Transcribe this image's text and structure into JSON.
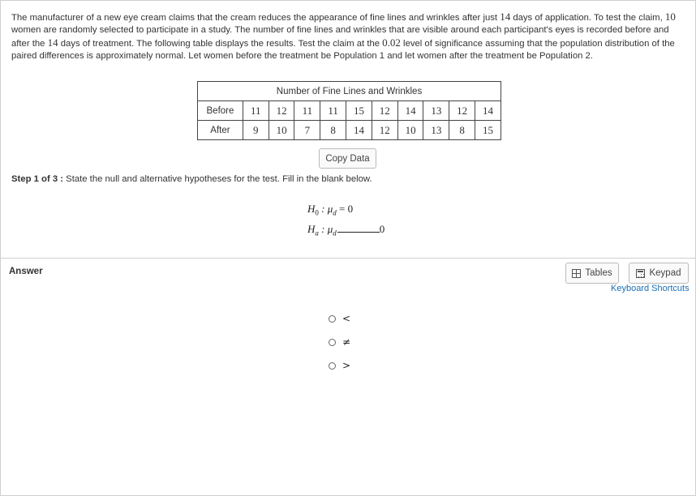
{
  "prompt": {
    "p1": "The manufacturer of a new eye cream claims that the cream reduces the appearance of fine lines and wrinkles after just ",
    "n1": "14",
    "p2": " days of application. To test the claim, ",
    "n2": "10",
    "p3": " women are randomly selected to participate in a study. The number of fine lines and wrinkles that are visible around each participant's eyes is recorded before and after the ",
    "n3": "14",
    "p4": " days of treatment. The following table displays the results. Test the claim at the ",
    "n4": "0.02",
    "p5": " level of significance assuming that the population distribution of the paired differences is approximately normal. Let women before the treatment be Population 1 and let women after the treatment be Population 2."
  },
  "table": {
    "caption": "Number of Fine Lines and Wrinkles",
    "before_label": "Before",
    "after_label": "After",
    "before": [
      "11",
      "12",
      "11",
      "11",
      "15",
      "12",
      "14",
      "13",
      "12",
      "14"
    ],
    "after": [
      "9",
      "10",
      "7",
      "8",
      "14",
      "12",
      "10",
      "13",
      "8",
      "15"
    ]
  },
  "copy_button": "Copy Data",
  "step": {
    "label": "Step 1 of 3 :",
    "text": " State the null and alternative hypotheses for the test. Fill in the blank below."
  },
  "hypotheses": {
    "h0_symbol": "H",
    "h0_sub": "0",
    "h0_body": " : μ",
    "h0_mu_sub": "d",
    "h0_rhs": " = 0",
    "ha_symbol": "H",
    "ha_sub": "a",
    "ha_body": " : μ",
    "ha_mu_sub": "d",
    "ha_rhs": "0"
  },
  "answer": {
    "label": "Answer",
    "tables_button": "Tables",
    "keypad_button": "Keypad",
    "shortcuts_link": "Keyboard Shortcuts",
    "options": [
      "<",
      "≠",
      ">"
    ]
  }
}
